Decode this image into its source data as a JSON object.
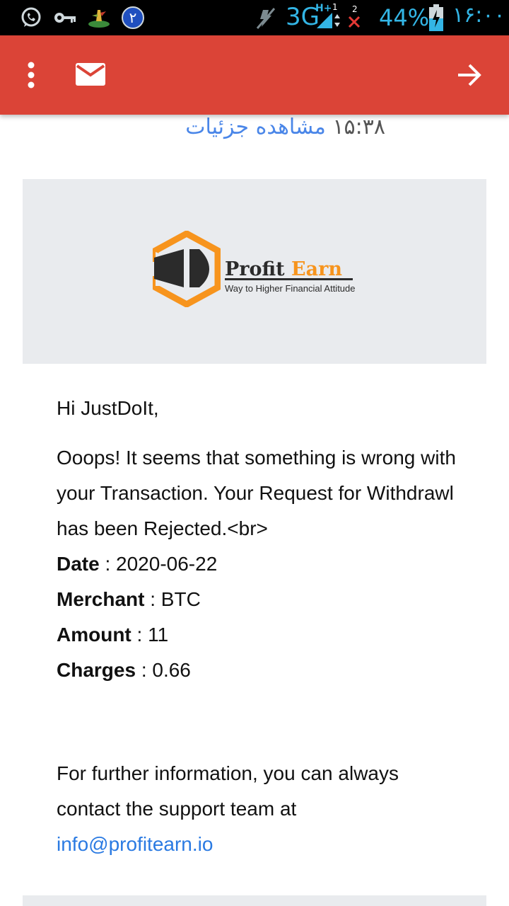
{
  "status_bar": {
    "icons": [
      "whatsapp-icon",
      "key-icon",
      "cactus-app-icon",
      "notification-count-icon",
      "mute-icon",
      "signal-icon",
      "no-signal-icon",
      "battery-icon"
    ],
    "notification_badge": "۲",
    "network_type": "3G",
    "network_sub": "H+",
    "sim1_badge": "1",
    "sim2_badge": "2",
    "battery_percent": "44%",
    "clock": "۱۶:۰۰"
  },
  "app_bar": {
    "background_color": "#db4437",
    "icons": [
      "more-vert-icon",
      "mail-icon",
      "arrow-forward-icon"
    ]
  },
  "message_meta": {
    "time": "۱۵:۳۸",
    "details_link": "مشاهده جزئیات"
  },
  "logo": {
    "brand_part1": "Profit",
    "brand_part2": "Earn",
    "tagline": "Way to Higher Financial Attitude",
    "accent_color": "#f7941d"
  },
  "email": {
    "greeting": "Hi JustDoIt,",
    "message": "Ooops! It seems that something is wrong with your Transaction. Your Request for Withdrawl has been Rejected.<br>",
    "details": [
      {
        "label": "Date",
        "value": " : 2020-06-22"
      },
      {
        "label": "Merchant",
        "value": " : BTC"
      },
      {
        "label": "Amount",
        "value": " : 11"
      },
      {
        "label": "Charges",
        "value": " : 0.66"
      }
    ],
    "footer_text": "For further information, you can always contact the support team at",
    "support_email": "info@profitearn.io"
  }
}
